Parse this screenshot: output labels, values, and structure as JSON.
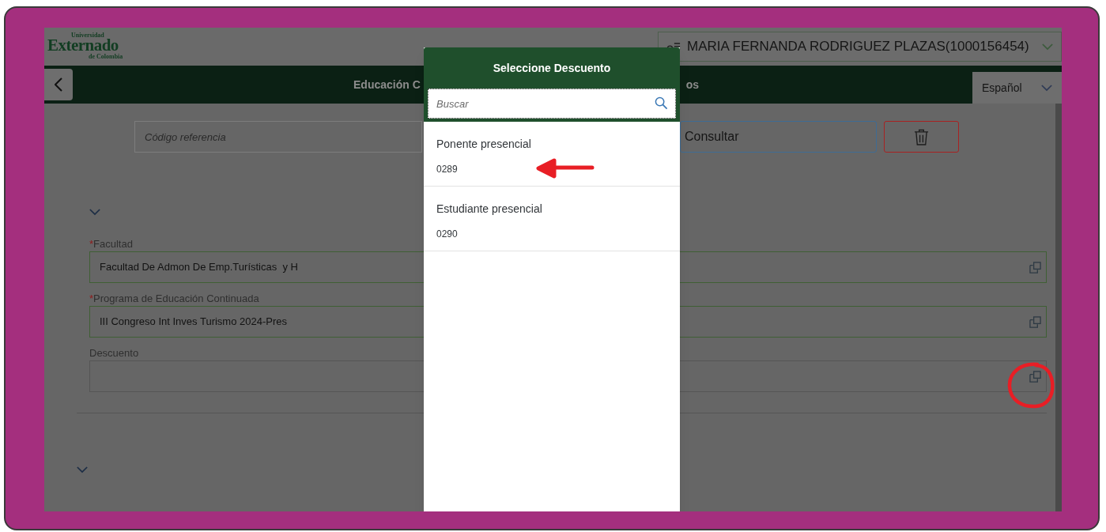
{
  "header": {
    "logo": {
      "top": "Universidad",
      "main": "Externado",
      "bottom": "de Colombia"
    },
    "user": "MARIA FERNANDA RODRIGUEZ PLAZAS(1000156454)"
  },
  "title_bar": {
    "title_parts": [
      "Educación C",
      "os"
    ],
    "language": "Español"
  },
  "search_row": {
    "reference": {
      "placeholder": "Código referencia"
    },
    "consult_button": "Consultar"
  },
  "fields": [
    {
      "marker": "*",
      "label": "Facultad",
      "value": "Facultad De Admon De Emp.Turísticas  y H"
    },
    {
      "marker": "*",
      "label": "Programa de Educación Continuada",
      "value": "III Congreso Int Inves Turismo 2024-Pres"
    },
    {
      "label": "Descuento"
    }
  ],
  "dialog": {
    "title": "Seleccione Descuento",
    "search": {
      "placeholder": "Buscar"
    },
    "items": [
      {
        "title": "Ponente presencial",
        "code": "0289"
      },
      {
        "title": "Estudiante presencial",
        "code": "0290"
      }
    ]
  }
}
